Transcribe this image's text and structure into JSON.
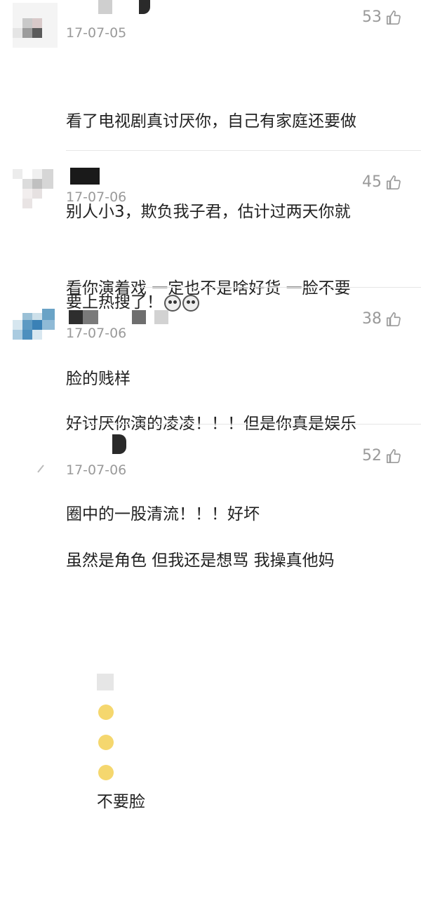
{
  "comments": [
    {
      "date": "17-07-05",
      "likes": "53",
      "text_lines": [
        "看了电视剧真讨厌你，自己有家庭还要做",
        "别人小3，欺负我子君，估计过两天你就",
        "要上热搜了！"
      ],
      "emoji": "dog-face-emoji"
    },
    {
      "date": "17-07-06",
      "likes": "45",
      "text_lines": [
        "看你演着戏 一定也不是啥好货 一脸不要",
        "脸的贱样"
      ]
    },
    {
      "date": "17-07-06",
      "likes": "38",
      "text_lines": [
        "好讨厌你演的凌凌！！！但是你真是娱乐",
        "圈中的一股清流！！！好坏"
      ]
    },
    {
      "date": "17-07-06",
      "likes": "52",
      "text_lines": [
        "虽然是角色 但我还是想骂 我操真他妈"
      ],
      "partial_line_end": "不要脸"
    }
  ],
  "icons": {
    "like": "thumbs-up-icon"
  },
  "colors": {
    "meta_gray": "#9a9a9a",
    "text": "#222222"
  }
}
